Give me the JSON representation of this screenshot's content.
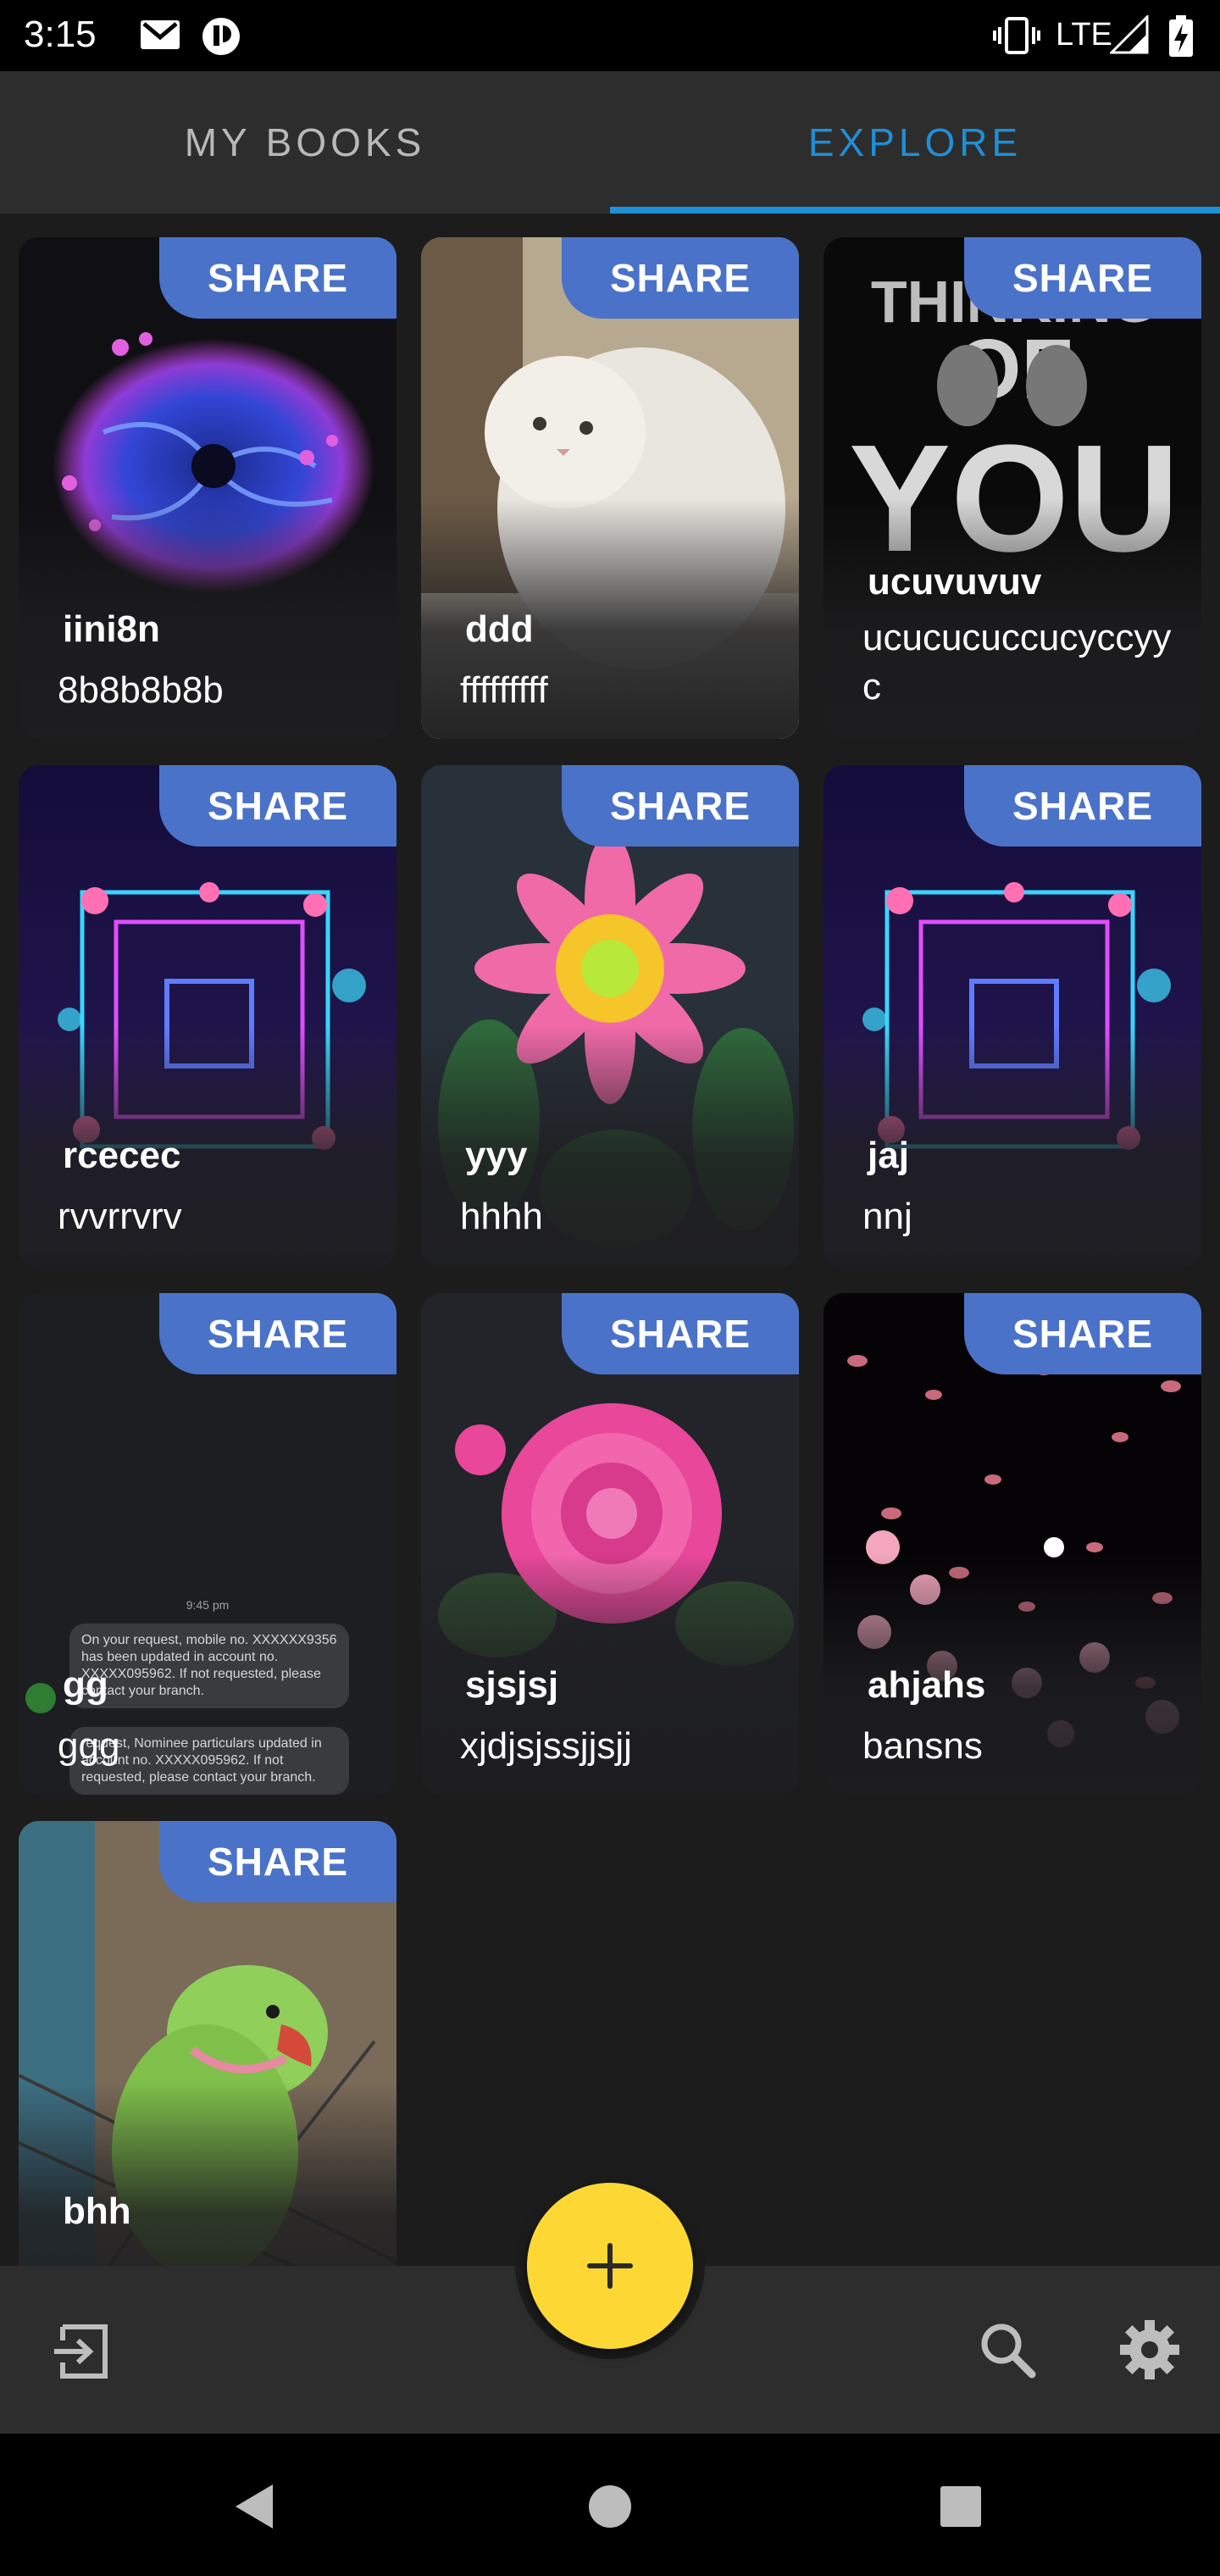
{
  "status_bar": {
    "time": "3:15",
    "network": "LTE",
    "icons": [
      "gmail-icon",
      "app-badge-icon",
      "vibrate-icon",
      "signal-icon",
      "battery-charging-icon"
    ]
  },
  "tabs": [
    {
      "label": "MY BOOKS",
      "selected": false
    },
    {
      "label": "EXPLORE",
      "selected": true
    }
  ],
  "colors": {
    "accent": "#1f8fd6",
    "share_badge": "#4a72c8",
    "fab": "#fdd835",
    "background": "#1c1c1c",
    "bar": "#2d2d2d"
  },
  "share_label": "SHARE",
  "books": [
    {
      "title": "iini8n",
      "subtitle": "8b8b8b8b",
      "art": "spiral-fractal-image"
    },
    {
      "title": "ddd",
      "subtitle": "fffffffff",
      "art": "white-cat-image"
    },
    {
      "title": "ucuvuvuv",
      "subtitle": "ucucucuccucyccyyc",
      "art": "thinking-of-you-poster-image"
    },
    {
      "title": "rcecec",
      "subtitle": "rvvrrvrv",
      "art": "neon-floral-frame-image"
    },
    {
      "title": "yyy",
      "subtitle": "hhhh",
      "art": "gerbera-flower-image"
    },
    {
      "title": "jaj",
      "subtitle": "nnj",
      "art": "neon-floral-frame-image"
    },
    {
      "title": "gg",
      "subtitle": "ggg",
      "art": "sms-screenshot-image"
    },
    {
      "title": "sjsjsj",
      "subtitle": "xjdjsjssjjsjj",
      "art": "pink-rose-image"
    },
    {
      "title": "ahjahs",
      "subtitle": "bansns",
      "art": "cherry-blossom-image"
    },
    {
      "title": "bhh",
      "subtitle": "",
      "art": "green-parrot-image"
    }
  ],
  "sms": {
    "time": "9:45 pm",
    "message1": "On your request, mobile no. XXXXXX9356 has been updated in account no. XXXXX095962. If not requested, please contact your branch.",
    "message2": "request, Nominee particulars updated in account no. XXXXX095962. If not requested, please contact your branch."
  },
  "poster_text": [
    "THINKING",
    "OF",
    "YOU"
  ],
  "bottom_bar": {
    "left_icon": "exit-icon",
    "right_icons": [
      "search-icon",
      "gear-icon"
    ],
    "fab_icon": "plus-icon"
  },
  "nav_bar": [
    "back-icon",
    "home-icon",
    "recents-icon"
  ]
}
